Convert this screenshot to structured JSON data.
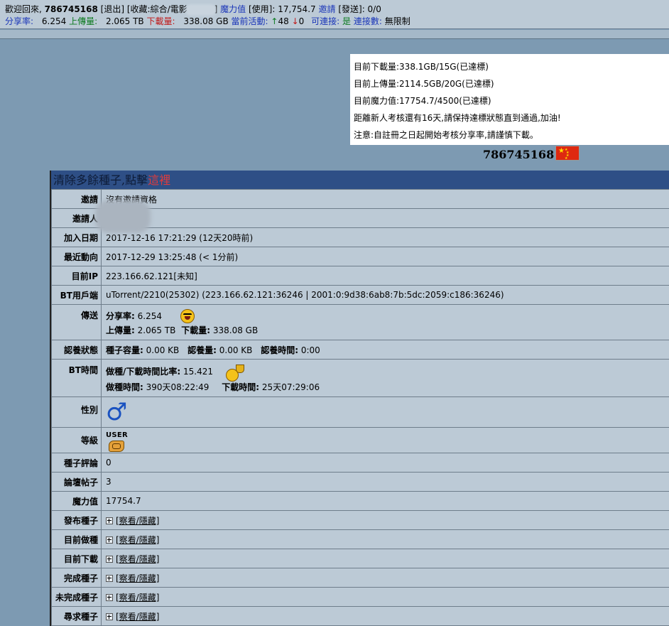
{
  "topbar": {
    "welcome": "歡迎回來,",
    "username": "786745168",
    "logout": "[退出]",
    "fav_prefix": "[收藏:",
    "fav_text": "綜合/電影",
    "fav_suffix": "]",
    "magic_label": "魔力值",
    "use_label": "[使用]: 17,754.7",
    "invite_label": "邀請",
    "sent_label": "[發送]: 0/0",
    "ratio_label": "分享率:",
    "ratio_value": "6.254",
    "upload_label": "上傳量:",
    "upload_value": "2.065 TB",
    "download_label": "下載量:",
    "download_value": "338.08 GB",
    "active_label": "當前活動:",
    "active_up": "48",
    "active_down": "0",
    "connectable_label": "可連接:",
    "connectable_value": "是",
    "connections_label": "連接數:",
    "connections_value": "無限制"
  },
  "notice": {
    "lines": [
      "目前下載量:338.1GB/15G(已達標)",
      "目前上傳量:2114.5GB/20G(已達標)",
      "目前魔力值:17754.7/4500(已達標)",
      "距離新人考核還有16天,請保持達標狀態直到通過,加油!",
      "注意:自註冊之日起開始考核分享率,請謹慎下載。"
    ]
  },
  "profile": {
    "username": "786745168",
    "flag_icon": "china-flag"
  },
  "panel": {
    "header_prefix": "清除多餘種子,點擊",
    "header_link": "這裡",
    "rows": {
      "invite": {
        "label": "邀請",
        "value": "沒有邀請資格"
      },
      "inviter": {
        "label": "邀請人",
        "value": ""
      },
      "join_date": {
        "label": "加入日期",
        "value": "2017-12-16 17:21:29 (12天20時前)"
      },
      "last_action": {
        "label": "最近動向",
        "value": "2017-12-29 13:25:48 (< 1分前)"
      },
      "ip": {
        "label": "目前IP",
        "value": "223.166.62.121[未知]"
      },
      "client": {
        "label": "BT用戶端",
        "value": "uTorrent/2210(25302) (223.166.62.121:36246 | 2001:0:9d38:6ab8:7b:5dc:2059:c186:36246)"
      },
      "transfer": {
        "label": "傳送",
        "ratio_label": "分享率:",
        "ratio_value": "6.254",
        "up_label": "上傳量:",
        "up_value": "2.065 TB",
        "down_label": "下載量:",
        "down_value": "338.08 GB"
      },
      "adoption": {
        "label": "認養狀態",
        "cap_label": "種子容量:",
        "cap_value": "0.00 KB",
        "amt_label": "認養量:",
        "amt_value": "0.00 KB",
        "time_label": "認養時間:",
        "time_value": "0:00"
      },
      "bt_time": {
        "label": "BT時間",
        "ratio_label": "做種/下載時間比率:",
        "ratio_value": "15.421",
        "seed_label": "做種時間:",
        "seed_value": "390天08:22:49",
        "leech_label": "下載時間:",
        "leech_value": "25天07:29:06"
      },
      "gender": {
        "label": "性別",
        "icon": "male-icon"
      },
      "level": {
        "label": "等級",
        "class_text": "USER",
        "icon": "user-class-icon"
      },
      "comments": {
        "label": "種子評論",
        "value": "0"
      },
      "forum_posts": {
        "label": "論壇帖子",
        "value": "3"
      },
      "magic": {
        "label": "魔力值",
        "value": "17754.7"
      },
      "published": {
        "label": "發布種子",
        "link": "[察看/隱藏]"
      },
      "seeding": {
        "label": "目前做種",
        "link": "[察看/隱藏]"
      },
      "leeching": {
        "label": "目前下載",
        "link": "[察看/隱藏]"
      },
      "completed": {
        "label": "完成種子",
        "link": "[察看/隱藏]"
      },
      "incomplete": {
        "label": "未完成種子",
        "link": "[察看/隱藏]"
      },
      "requested": {
        "label": "尋求種子",
        "link": "[察看/隱藏]"
      }
    }
  },
  "colors": {
    "page_bg": "#7d9ab2",
    "bar_bg": "#bccad6",
    "header_bg": "#2e4f86",
    "link_red": "#e23b3b",
    "link_blue": "#1a35b8"
  }
}
